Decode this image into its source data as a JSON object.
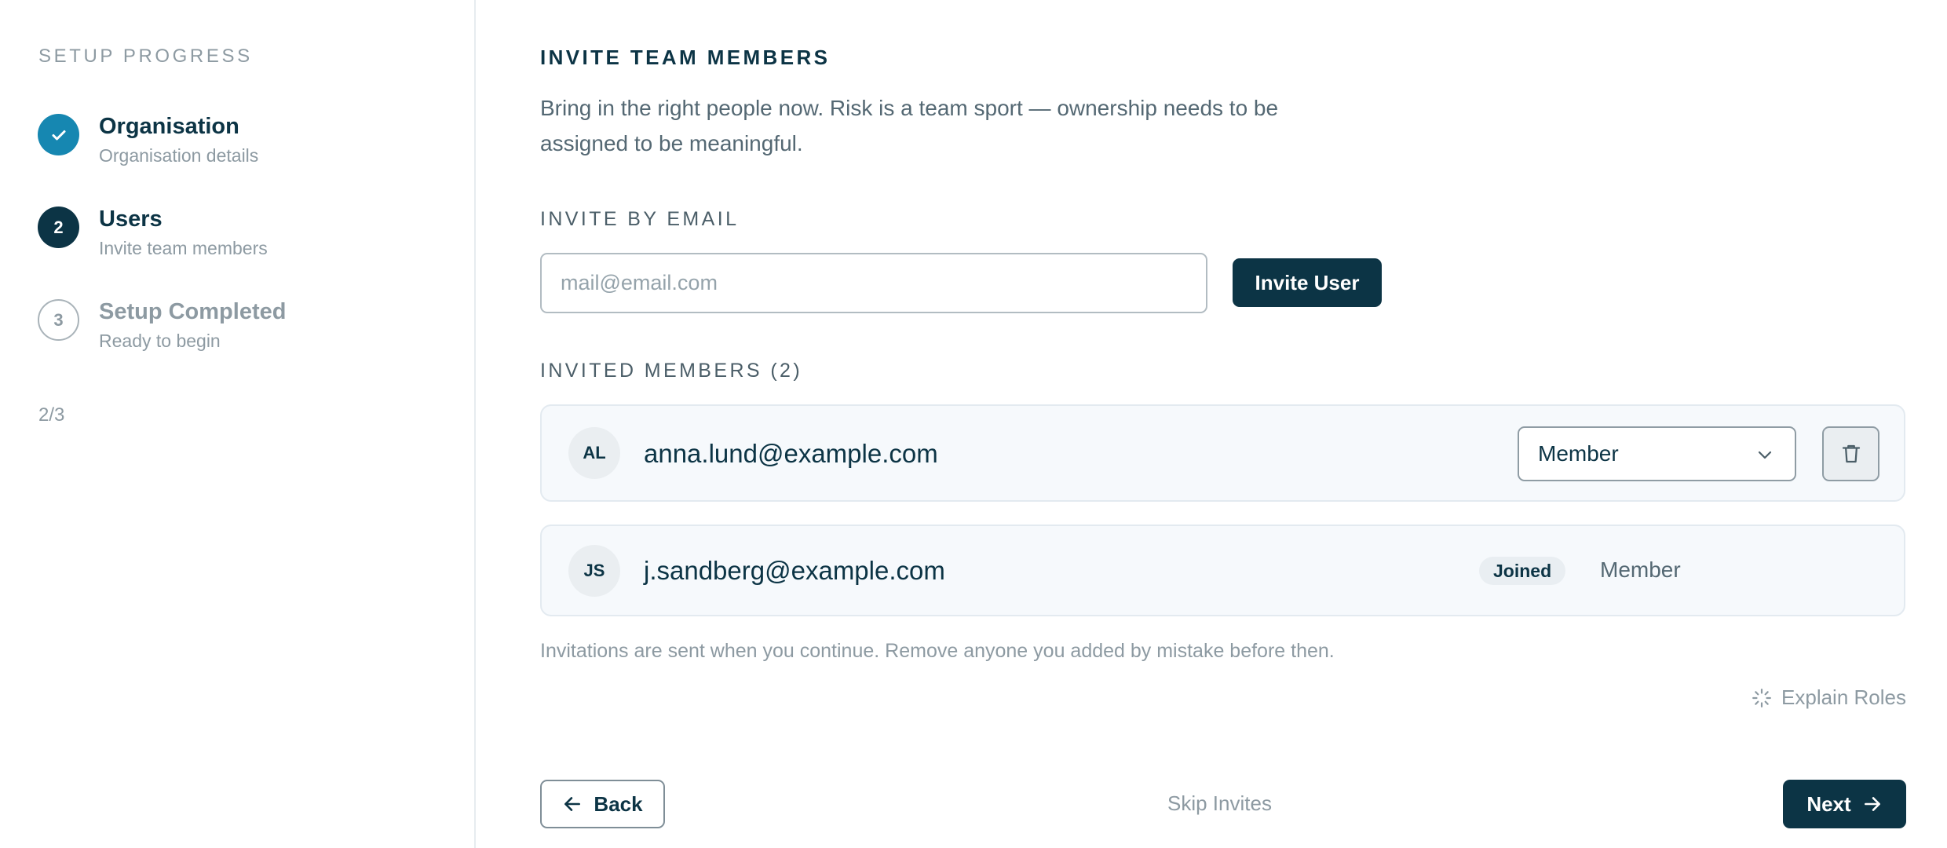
{
  "sidebar": {
    "title": "SETUP PROGRESS",
    "steps": [
      {
        "indicator": "",
        "label": "Organisation",
        "sub": "Organisation details",
        "state": "done"
      },
      {
        "indicator": "2",
        "label": "Users",
        "sub": "Invite team members",
        "state": "current"
      },
      {
        "indicator": "3",
        "label": "Setup Completed",
        "sub": "Ready to begin",
        "state": "pending"
      }
    ],
    "progress": "2/3"
  },
  "main": {
    "heading": "INVITE TEAM MEMBERS",
    "intro": "Bring in the right people now. Risk is a team sport — ownership needs to be assigned to be meaningful.",
    "invite_label": "INVITE BY EMAIL",
    "email_placeholder": "mail@email.com",
    "email_value": "",
    "invite_button": "Invite User",
    "members_label": "INVITED MEMBERS (2)",
    "members": [
      {
        "initials": "AL",
        "email": "anna.lund@example.com",
        "role": "Member",
        "status": "",
        "editable": true
      },
      {
        "initials": "JS",
        "email": "j.sandberg@example.com",
        "role": "Member",
        "status": "Joined",
        "editable": false
      }
    ],
    "hint": "Invitations are sent when you continue. Remove anyone you added by mistake before then.",
    "explain_roles": "Explain Roles",
    "back_button": "Back",
    "skip_link": "Skip Invites",
    "next_button": "Next"
  },
  "colors": {
    "primary": "#0c3445",
    "done": "#1687b1",
    "muted": "#8d9aa2",
    "row_bg": "#f6f9fc"
  },
  "icons": {
    "done_step": "check-icon",
    "select": "chevron-down-icon",
    "delete": "trash-icon",
    "explain": "spinner-icon",
    "back": "arrow-left-icon",
    "next": "arrow-right-icon"
  }
}
